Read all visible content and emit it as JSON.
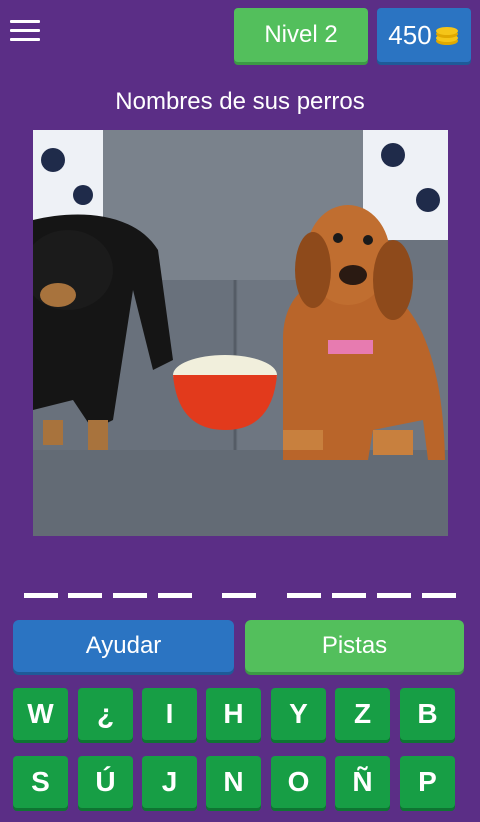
{
  "header": {
    "level_label": "Nivel 2",
    "coins": "450"
  },
  "puzzle": {
    "title": "Nombres de sus perros",
    "image_icon": "dogs-on-couch-photo"
  },
  "answer": {
    "words": [
      4,
      1,
      4
    ]
  },
  "actions": {
    "help_label": "Ayudar",
    "hints_label": "Pistas"
  },
  "keyboard": {
    "row1": [
      "W",
      "¿",
      "I",
      "H",
      "Y",
      "Z",
      "B"
    ],
    "row2": [
      "S",
      "Ú",
      "J",
      "N",
      "O",
      "Ñ",
      "P"
    ]
  },
  "colors": {
    "background": "#5b2e86",
    "green": "#53bf5c",
    "blue": "#2b74c2",
    "key_green": "#179e45",
    "coin_gold": "#f5c518"
  }
}
